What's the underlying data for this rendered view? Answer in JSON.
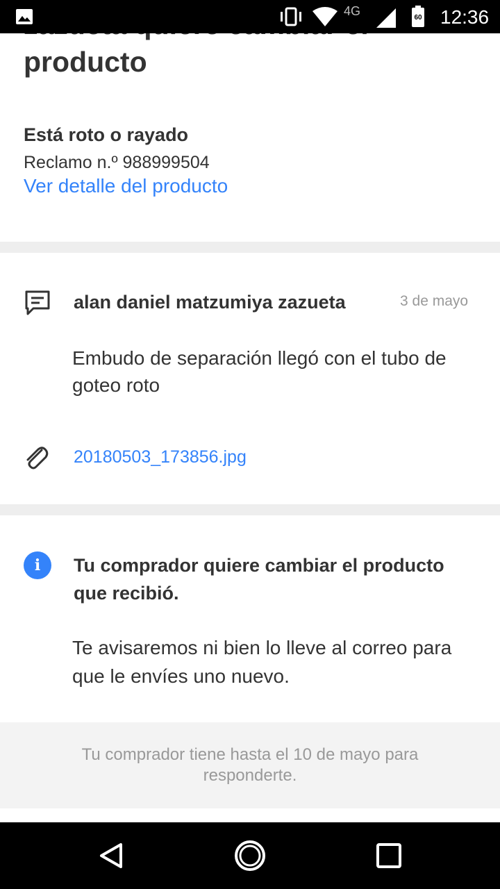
{
  "status_bar": {
    "network_type": "4G",
    "battery_level": "60",
    "time": "12:36"
  },
  "header": {
    "title": "zazueta quiere cambiar el producto",
    "reason": "Está roto o rayado",
    "claim_number": "Reclamo n.º 988999504",
    "detail_link": "Ver detalle del producto"
  },
  "message": {
    "author": "alan daniel matzumiya zazueta",
    "date": "3 de mayo",
    "text": "Embudo de separación llegó con el tubo de goteo roto",
    "attachment": "20180503_173856.jpg"
  },
  "info": {
    "title": "Tu comprador quiere cambiar el producto que recibió.",
    "body": "Te avisaremos ni bien lo lleve al correo para que le envíes uno nuevo."
  },
  "notice": {
    "text": "Tu comprador tiene hasta el 10 de mayo para responderte."
  },
  "colors": {
    "link": "#3483fa",
    "info_icon": "#3483fa"
  }
}
